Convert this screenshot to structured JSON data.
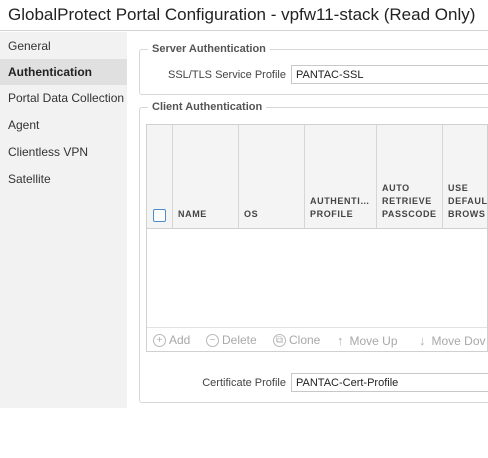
{
  "window": {
    "title": "GlobalProtect Portal Configuration - vpfw11-stack (Read Only)"
  },
  "sidebar": {
    "items": [
      {
        "label": "General"
      },
      {
        "label": "Authentication"
      },
      {
        "label": "Portal Data Collection"
      },
      {
        "label": "Agent"
      },
      {
        "label": "Clientless VPN"
      },
      {
        "label": "Satellite"
      }
    ],
    "active": "Authentication"
  },
  "server_auth": {
    "legend": "Server Authentication",
    "ssl_label": "SSL/TLS Service Profile",
    "ssl_value": "PANTAC-SSL"
  },
  "client_auth": {
    "legend": "Client Authentication",
    "columns": [
      {
        "label": "NAME"
      },
      {
        "label": "OS"
      },
      {
        "label": "AUTHENTI…\nPROFILE"
      },
      {
        "label": "AUTO\nRETRIEVE\nPASSCODE"
      },
      {
        "label": "USE\nDEFAUL\nBROWS"
      }
    ],
    "toolbar": {
      "add": "Add",
      "delete": "Delete",
      "clone": "Clone",
      "move_up": "Move Up",
      "move_down": "Move Dov"
    },
    "cert_label": "Certificate Profile",
    "cert_value": "PANTAC-Cert-Profile"
  }
}
